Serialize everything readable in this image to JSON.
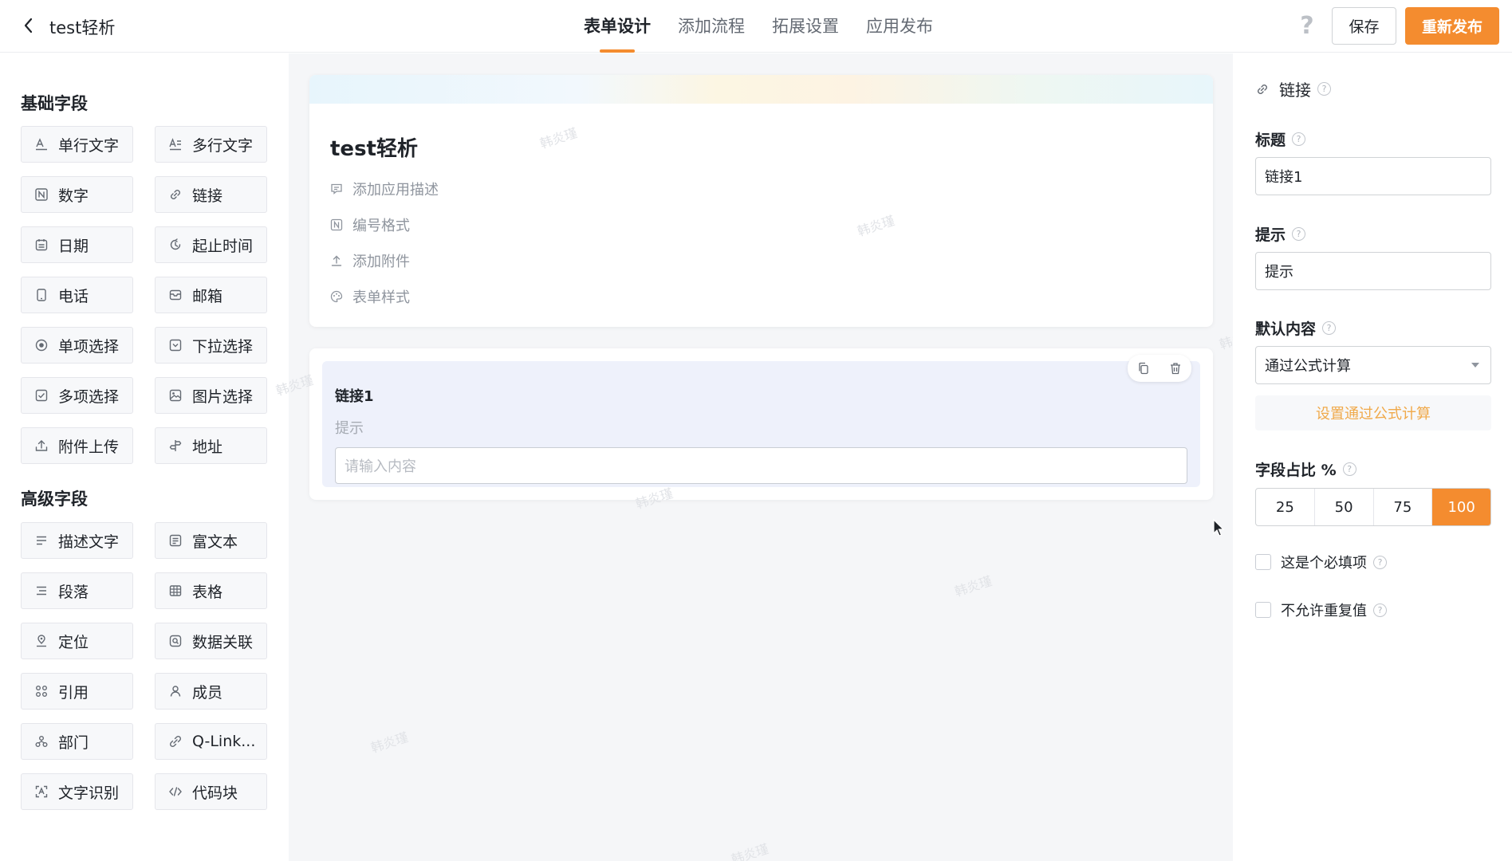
{
  "header": {
    "app_title": "test轻析",
    "tabs": [
      {
        "label": "表单设计",
        "active": true
      },
      {
        "label": "添加流程",
        "active": false
      },
      {
        "label": "拓展设置",
        "active": false
      },
      {
        "label": "应用发布",
        "active": false
      }
    ],
    "help_icon": "?",
    "save_label": "保存",
    "publish_label": "重新发布"
  },
  "sidebar": {
    "basic_title": "基础字段",
    "basic_fields": [
      {
        "label": "单行文字",
        "icon": "single-line-text-icon"
      },
      {
        "label": "多行文字",
        "icon": "multi-line-text-icon"
      },
      {
        "label": "数字",
        "icon": "number-icon"
      },
      {
        "label": "链接",
        "icon": "link-icon"
      },
      {
        "label": "日期",
        "icon": "calendar-icon"
      },
      {
        "label": "起止时间",
        "icon": "time-range-icon"
      },
      {
        "label": "电话",
        "icon": "phone-icon"
      },
      {
        "label": "邮箱",
        "icon": "mail-icon"
      },
      {
        "label": "单项选择",
        "icon": "radio-icon"
      },
      {
        "label": "下拉选择",
        "icon": "dropdown-icon"
      },
      {
        "label": "多项选择",
        "icon": "checkbox-icon"
      },
      {
        "label": "图片选择",
        "icon": "image-icon"
      },
      {
        "label": "附件上传",
        "icon": "upload-icon"
      },
      {
        "label": "地址",
        "icon": "address-icon"
      }
    ],
    "advanced_title": "高级字段",
    "advanced_fields": [
      {
        "label": "描述文字",
        "icon": "description-icon"
      },
      {
        "label": "富文本",
        "icon": "rich-text-icon"
      },
      {
        "label": "段落",
        "icon": "paragraph-icon"
      },
      {
        "label": "表格",
        "icon": "table-icon"
      },
      {
        "label": "定位",
        "icon": "location-icon"
      },
      {
        "label": "数据关联",
        "icon": "data-link-icon"
      },
      {
        "label": "引用",
        "icon": "reference-icon"
      },
      {
        "label": "成员",
        "icon": "member-icon"
      },
      {
        "label": "部门",
        "icon": "department-icon"
      },
      {
        "label": "Q-Link...",
        "icon": "qlink-icon"
      },
      {
        "label": "文字识别",
        "icon": "ocr-icon"
      },
      {
        "label": "代码块",
        "icon": "code-icon"
      }
    ]
  },
  "canvas": {
    "form_title": "test轻析",
    "meta_items": [
      "添加应用描述",
      "编号格式",
      "添加附件",
      "表单样式"
    ],
    "field": {
      "title": "链接1",
      "hint": "提示",
      "placeholder": "请输入内容"
    },
    "watermark": "韩炎瑾"
  },
  "panel": {
    "heading": "链接",
    "title_label": "标题",
    "title_value": "链接1",
    "hint_label": "提示",
    "hint_value": "提示",
    "default_label": "默认内容",
    "default_value": "通过公式计算",
    "formula_button": "设置通过公式计算",
    "ratio_label": "字段占比 %",
    "ratio_options": [
      "25",
      "50",
      "75",
      "100"
    ],
    "ratio_selected": "100",
    "required_label": "这是个必填项",
    "no_duplicate_label": "不允许重复值"
  },
  "colors": {
    "accent": "#f48c2f",
    "selected_field_bg": "#eef1fb",
    "formula_text": "#f0a94a"
  }
}
